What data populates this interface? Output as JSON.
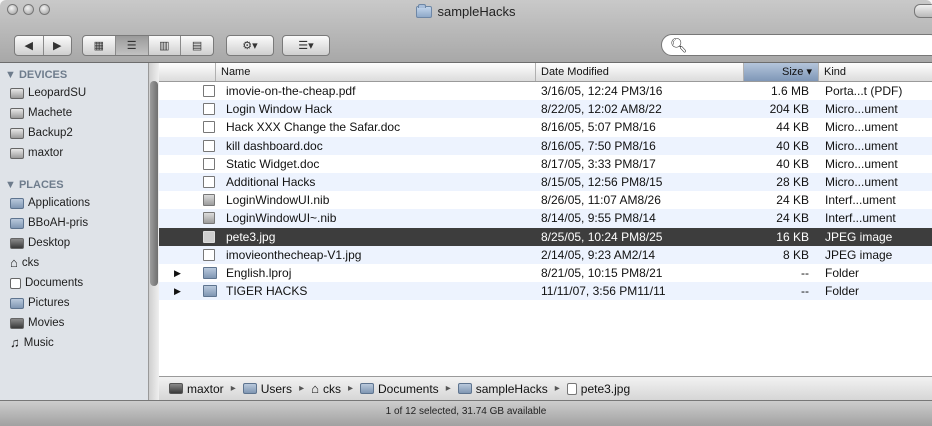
{
  "window": {
    "title": "sampleHacks"
  },
  "toolbar": {
    "back_label": "◀",
    "forward_label": "▶",
    "view_icon": "▦ ☰ ▥ ▤",
    "action_label": "⚙▾",
    "arrange_label": "☰▾",
    "search_placeholder": ""
  },
  "sidebar": {
    "devices_header": "▼ DEVICES",
    "devices": [
      "LeopardSU",
      "Machete",
      "Backup2",
      "maxtor"
    ],
    "places_header": "▼ PLACES",
    "places": [
      "Applications",
      "BBoAH-pris",
      "Desktop",
      "cks",
      "Documents",
      "Pictures",
      "Movies",
      "Music"
    ]
  },
  "columns": {
    "name": "Name",
    "date": "Date Modified",
    "size": "Size ▾",
    "kind": "Kind"
  },
  "files": [
    {
      "name": "imovie-on-the-cheap.pdf",
      "date": "3/16/05, 12:24 PM3/16",
      "size": "1.6 MB",
      "kind": "Porta...t (PDF)",
      "icon": "doc-icon"
    },
    {
      "name": "Login Window Hack",
      "date": "8/22/05, 12:02 AM8/22",
      "size": "204 KB",
      "kind": "Micro...ument",
      "icon": "doc-icon"
    },
    {
      "name": "Hack XXX Change the Safar.doc",
      "date": "8/16/05, 5:07 PM8/16",
      "size": "44 KB",
      "kind": "Micro...ument",
      "icon": "doc-icon"
    },
    {
      "name": "kill dashboard.doc",
      "date": "8/16/05, 7:50 PM8/16",
      "size": "40 KB",
      "kind": "Micro...ument",
      "icon": "doc-icon"
    },
    {
      "name": "Static Widget.doc",
      "date": "8/17/05, 3:33 PM8/17",
      "size": "40 KB",
      "kind": "Micro...ument",
      "icon": "doc-icon"
    },
    {
      "name": "Additional Hacks",
      "date": "8/15/05, 12:56 PM8/15",
      "size": "28 KB",
      "kind": "Micro...ument",
      "icon": "doc-icon"
    },
    {
      "name": "LoginWindowUI.nib",
      "date": "8/26/05, 11:07 AM8/26",
      "size": "24 KB",
      "kind": "Interf...ument",
      "icon": "nib-icon"
    },
    {
      "name": "LoginWindowUI~.nib",
      "date": "8/14/05, 9:55 PM8/14",
      "size": "24 KB",
      "kind": "Interf...ument",
      "icon": "nib-icon"
    },
    {
      "name": "pete3.jpg",
      "date": "8/25/05, 10:24 PM8/25",
      "size": "16 KB",
      "kind": "JPEG image",
      "icon": "image-icon",
      "selected": true
    },
    {
      "name": "imovieonthecheap-V1.jpg",
      "date": "2/14/05, 9:23 AM2/14",
      "size": "8 KB",
      "kind": "JPEG image",
      "icon": "image-icon"
    },
    {
      "name": "English.lproj",
      "date": "8/21/05, 10:15 PM8/21",
      "size": "--",
      "kind": "Folder",
      "icon": "folder-icon",
      "disclosure": "▶"
    },
    {
      "name": "TIGER HACKS",
      "date": "11/11/07, 3:56 PM11/11",
      "size": "--",
      "kind": "Folder",
      "icon": "folder-icon",
      "disclosure": "▶"
    }
  ],
  "pathbar": {
    "items": [
      "maxtor",
      "Users",
      "cks",
      "Documents",
      "sampleHacks",
      "pete3.jpg"
    ],
    "separator": "▸"
  },
  "status": {
    "text": "1 of 12 selected, 31.74 GB available"
  }
}
